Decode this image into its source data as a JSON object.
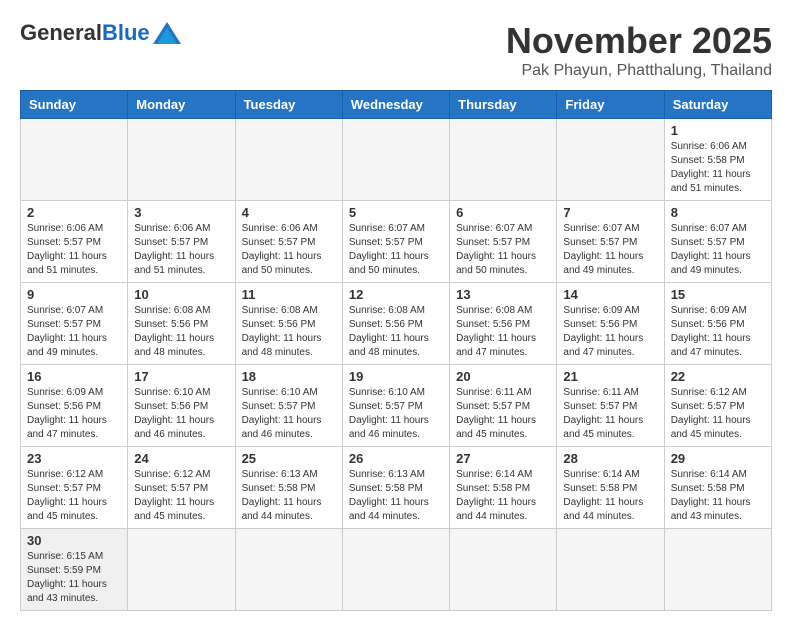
{
  "logo": {
    "general": "General",
    "blue": "Blue"
  },
  "header": {
    "month": "November 2025",
    "location": "Pak Phayun, Phatthalung, Thailand"
  },
  "weekdays": [
    "Sunday",
    "Monday",
    "Tuesday",
    "Wednesday",
    "Thursday",
    "Friday",
    "Saturday"
  ],
  "weeks": [
    [
      {
        "day": "",
        "info": ""
      },
      {
        "day": "",
        "info": ""
      },
      {
        "day": "",
        "info": ""
      },
      {
        "day": "",
        "info": ""
      },
      {
        "day": "",
        "info": ""
      },
      {
        "day": "",
        "info": ""
      },
      {
        "day": "1",
        "info": "Sunrise: 6:06 AM\nSunset: 5:58 PM\nDaylight: 11 hours and 51 minutes."
      }
    ],
    [
      {
        "day": "2",
        "info": "Sunrise: 6:06 AM\nSunset: 5:57 PM\nDaylight: 11 hours and 51 minutes."
      },
      {
        "day": "3",
        "info": "Sunrise: 6:06 AM\nSunset: 5:57 PM\nDaylight: 11 hours and 51 minutes."
      },
      {
        "day": "4",
        "info": "Sunrise: 6:06 AM\nSunset: 5:57 PM\nDaylight: 11 hours and 50 minutes."
      },
      {
        "day": "5",
        "info": "Sunrise: 6:07 AM\nSunset: 5:57 PM\nDaylight: 11 hours and 50 minutes."
      },
      {
        "day": "6",
        "info": "Sunrise: 6:07 AM\nSunset: 5:57 PM\nDaylight: 11 hours and 50 minutes."
      },
      {
        "day": "7",
        "info": "Sunrise: 6:07 AM\nSunset: 5:57 PM\nDaylight: 11 hours and 49 minutes."
      },
      {
        "day": "8",
        "info": "Sunrise: 6:07 AM\nSunset: 5:57 PM\nDaylight: 11 hours and 49 minutes."
      }
    ],
    [
      {
        "day": "9",
        "info": "Sunrise: 6:07 AM\nSunset: 5:57 PM\nDaylight: 11 hours and 49 minutes."
      },
      {
        "day": "10",
        "info": "Sunrise: 6:08 AM\nSunset: 5:56 PM\nDaylight: 11 hours and 48 minutes."
      },
      {
        "day": "11",
        "info": "Sunrise: 6:08 AM\nSunset: 5:56 PM\nDaylight: 11 hours and 48 minutes."
      },
      {
        "day": "12",
        "info": "Sunrise: 6:08 AM\nSunset: 5:56 PM\nDaylight: 11 hours and 48 minutes."
      },
      {
        "day": "13",
        "info": "Sunrise: 6:08 AM\nSunset: 5:56 PM\nDaylight: 11 hours and 47 minutes."
      },
      {
        "day": "14",
        "info": "Sunrise: 6:09 AM\nSunset: 5:56 PM\nDaylight: 11 hours and 47 minutes."
      },
      {
        "day": "15",
        "info": "Sunrise: 6:09 AM\nSunset: 5:56 PM\nDaylight: 11 hours and 47 minutes."
      }
    ],
    [
      {
        "day": "16",
        "info": "Sunrise: 6:09 AM\nSunset: 5:56 PM\nDaylight: 11 hours and 47 minutes."
      },
      {
        "day": "17",
        "info": "Sunrise: 6:10 AM\nSunset: 5:56 PM\nDaylight: 11 hours and 46 minutes."
      },
      {
        "day": "18",
        "info": "Sunrise: 6:10 AM\nSunset: 5:57 PM\nDaylight: 11 hours and 46 minutes."
      },
      {
        "day": "19",
        "info": "Sunrise: 6:10 AM\nSunset: 5:57 PM\nDaylight: 11 hours and 46 minutes."
      },
      {
        "day": "20",
        "info": "Sunrise: 6:11 AM\nSunset: 5:57 PM\nDaylight: 11 hours and 45 minutes."
      },
      {
        "day": "21",
        "info": "Sunrise: 6:11 AM\nSunset: 5:57 PM\nDaylight: 11 hours and 45 minutes."
      },
      {
        "day": "22",
        "info": "Sunrise: 6:12 AM\nSunset: 5:57 PM\nDaylight: 11 hours and 45 minutes."
      }
    ],
    [
      {
        "day": "23",
        "info": "Sunrise: 6:12 AM\nSunset: 5:57 PM\nDaylight: 11 hours and 45 minutes."
      },
      {
        "day": "24",
        "info": "Sunrise: 6:12 AM\nSunset: 5:57 PM\nDaylight: 11 hours and 45 minutes."
      },
      {
        "day": "25",
        "info": "Sunrise: 6:13 AM\nSunset: 5:58 PM\nDaylight: 11 hours and 44 minutes."
      },
      {
        "day": "26",
        "info": "Sunrise: 6:13 AM\nSunset: 5:58 PM\nDaylight: 11 hours and 44 minutes."
      },
      {
        "day": "27",
        "info": "Sunrise: 6:14 AM\nSunset: 5:58 PM\nDaylight: 11 hours and 44 minutes."
      },
      {
        "day": "28",
        "info": "Sunrise: 6:14 AM\nSunset: 5:58 PM\nDaylight: 11 hours and 44 minutes."
      },
      {
        "day": "29",
        "info": "Sunrise: 6:14 AM\nSunset: 5:58 PM\nDaylight: 11 hours and 43 minutes."
      }
    ],
    [
      {
        "day": "30",
        "info": "Sunrise: 6:15 AM\nSunset: 5:59 PM\nDaylight: 11 hours and 43 minutes."
      },
      {
        "day": "",
        "info": ""
      },
      {
        "day": "",
        "info": ""
      },
      {
        "day": "",
        "info": ""
      },
      {
        "day": "",
        "info": ""
      },
      {
        "day": "",
        "info": ""
      },
      {
        "day": "",
        "info": ""
      }
    ]
  ]
}
